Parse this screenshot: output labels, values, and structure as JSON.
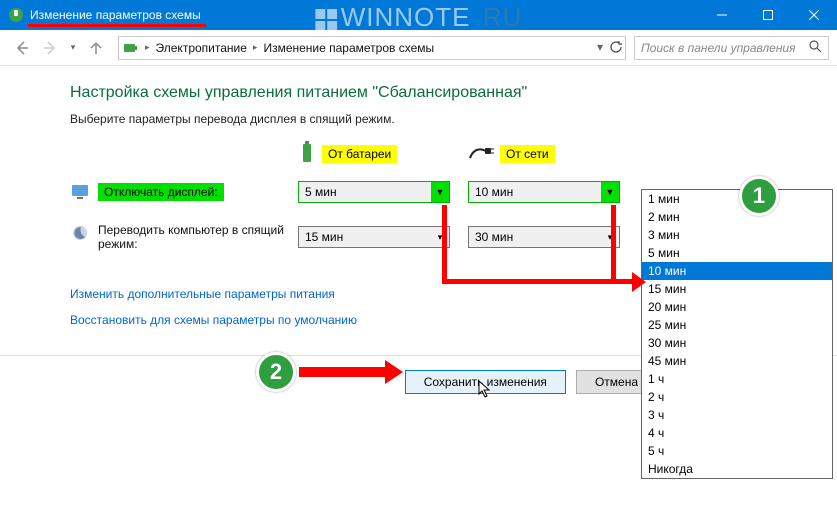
{
  "window": {
    "title": "Изменение параметров схемы",
    "watermark_a": "WINNOTE",
    "watermark_b": ".RU"
  },
  "nav": {
    "crumb1": "Электропитание",
    "crumb2": "Изменение параметров схемы",
    "search_placeholder": "Поиск в панели управления"
  },
  "page": {
    "heading": "Настройка схемы управления питанием \"Сбалансированная\"",
    "subtext": "Выберите параметры перевода дисплея в спящий режим.",
    "mode_battery": "От батареи",
    "mode_ac": "От сети",
    "row_display_label": "Отключать дисплей:",
    "row_sleep_label": "Переводить компьютер в спящий режим:",
    "display_battery_value": "5 мин",
    "display_ac_value": "10 мин",
    "sleep_battery_value": "15 мин",
    "sleep_ac_value": "30 мин",
    "link_advanced": "Изменить дополнительные параметры питания",
    "link_restore": "Восстановить для схемы параметры по умолчанию",
    "btn_save": "Сохранить изменения",
    "btn_cancel": "Отмена"
  },
  "dropdown": {
    "options": [
      "1 мин",
      "2 мин",
      "3 мин",
      "5 мин",
      "10 мин",
      "15 мин",
      "20 мин",
      "25 мин",
      "30 мин",
      "45 мин",
      "1 ч",
      "2 ч",
      "3 ч",
      "4 ч",
      "5 ч",
      "Никогда"
    ],
    "selected": "10 мин"
  },
  "annotations": {
    "badge1": "1",
    "badge2": "2"
  }
}
